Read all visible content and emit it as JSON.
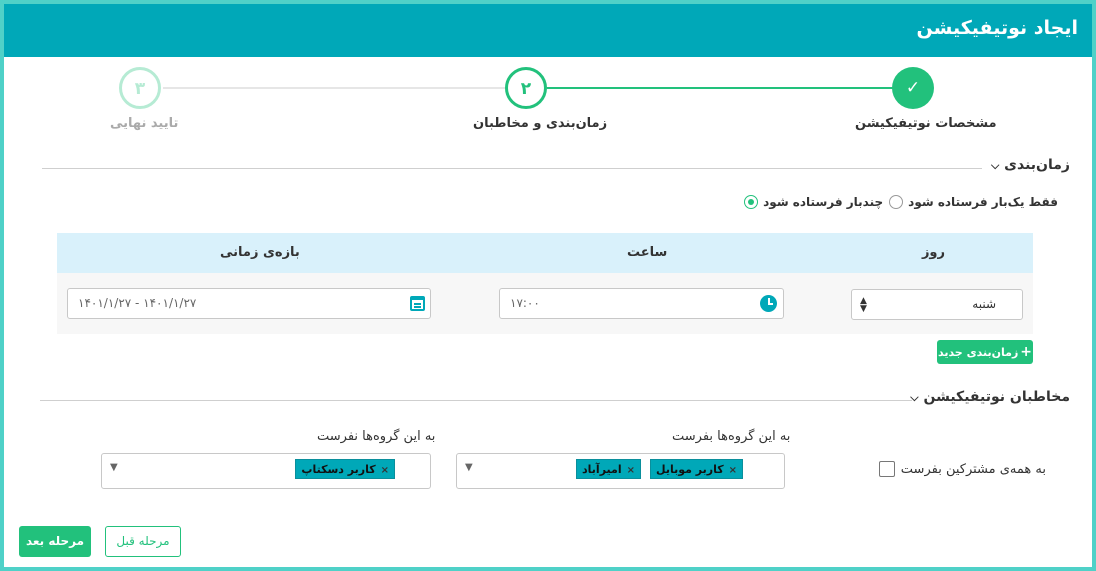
{
  "header": {
    "title": "ایجاد نوتیفیکیشن"
  },
  "stepper": {
    "steps": [
      {
        "label": "مشخصات نوتیفیکیشن",
        "marker": "✓",
        "state": "done"
      },
      {
        "label": "زمان‌بندی و مخاطبان",
        "marker": "۲",
        "state": "active"
      },
      {
        "label": "تایید نهایی",
        "marker": "۳",
        "state": "pending"
      }
    ]
  },
  "scheduling": {
    "title": "زمان‌بندی",
    "options": [
      {
        "label": "فقط یک‌بار فرستاده شود",
        "checked": false
      },
      {
        "label": "چندبار فرستاده شود",
        "checked": true
      }
    ],
    "table": {
      "headers": {
        "day": "روز",
        "time": "ساعت",
        "range": "بازه‌ی زمانی"
      },
      "row": {
        "day": "شنبه",
        "time": "۱۷:۰۰",
        "range": "۱۴۰۱/۱/۲۷ - ۱۴۰۱/۱/۲۷"
      }
    },
    "add_button": "زمان‌بندی جدید"
  },
  "recipients": {
    "title": "مخاطبان نوتیفیکیشن",
    "all_subscribers_label": "به همه‌ی مشترکین بفرست",
    "send_groups": {
      "label": "به این گروه‌ها بفرست",
      "tags": [
        "کاربر موبایل",
        "امیرآباد"
      ]
    },
    "exclude_groups": {
      "label": "به این گروه‌ها نفرست",
      "tags": [
        "کاربر دسکتاپ"
      ]
    }
  },
  "footer": {
    "next_label": "مرحله بعد",
    "prev_label": "مرحله قبل"
  },
  "colors": {
    "header": "#00a8b8",
    "success": "#22c17c",
    "table_head": "#d9f1fb",
    "frame": "#4fd1c8"
  },
  "icons": {
    "check": "check-icon",
    "clock": "clock-icon",
    "calendar": "calendar-icon",
    "chevron": "chevron-down-icon",
    "plus": "plus-icon"
  }
}
